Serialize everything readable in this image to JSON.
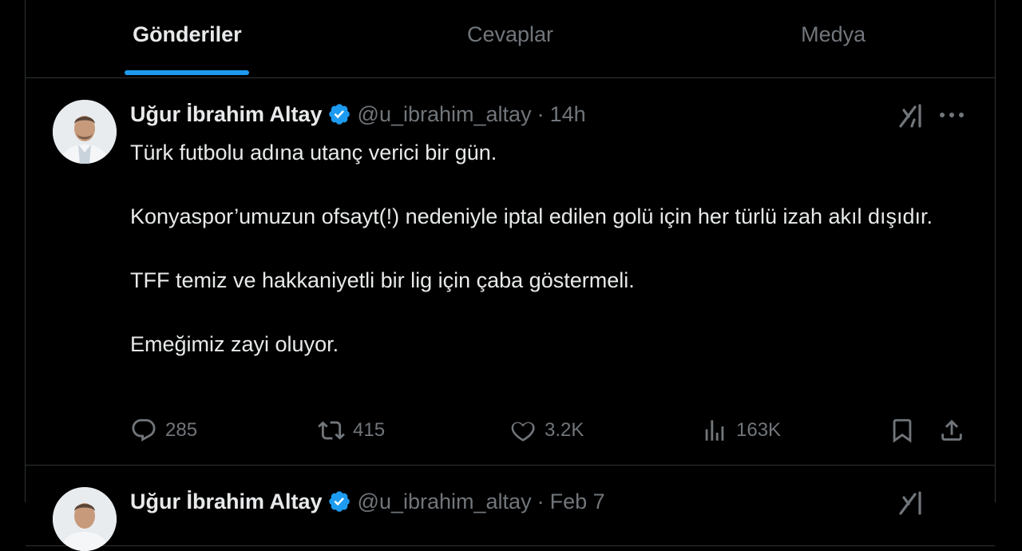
{
  "tabs": [
    {
      "label": "Gönderiler",
      "active": true
    },
    {
      "label": "Cevaplar",
      "active": false
    },
    {
      "label": "Medya",
      "active": false
    }
  ],
  "tweets": [
    {
      "name": "Uğur İbrahim Altay",
      "handle": "@u_ibrahim_altay",
      "separator": "·",
      "time": "14h",
      "paragraphs": [
        "Türk futbolu adına utanç verici bir gün.",
        "Konyaspor’umuzun ofsayt(!) nedeniyle iptal edilen golü için her türlü izah akıl dışıdır.",
        "TFF temiz ve hakkaniyetli bir lig için çaba göstermeli.",
        "Emeğimiz zayi oluyor."
      ],
      "stats": {
        "replies": "285",
        "retweets": "415",
        "likes": "3.2K",
        "views": "163K"
      }
    },
    {
      "name": "Uğur İbrahim Altay",
      "handle": "@u_ibrahim_altay",
      "separator": "·",
      "time": "Feb 7"
    }
  ],
  "icons": {
    "verified": "verified-badge-icon",
    "grok": "grok-icon",
    "more": "more-icon",
    "reply": "reply-icon",
    "retweet": "retweet-icon",
    "like": "heart-icon",
    "views": "views-icon",
    "bookmark": "bookmark-icon",
    "share": "share-icon"
  },
  "colors": {
    "accent": "#1d9bf0",
    "muted": "#71767b",
    "text": "#e7e9ea",
    "border": "#2f3336",
    "background": "#000000"
  }
}
